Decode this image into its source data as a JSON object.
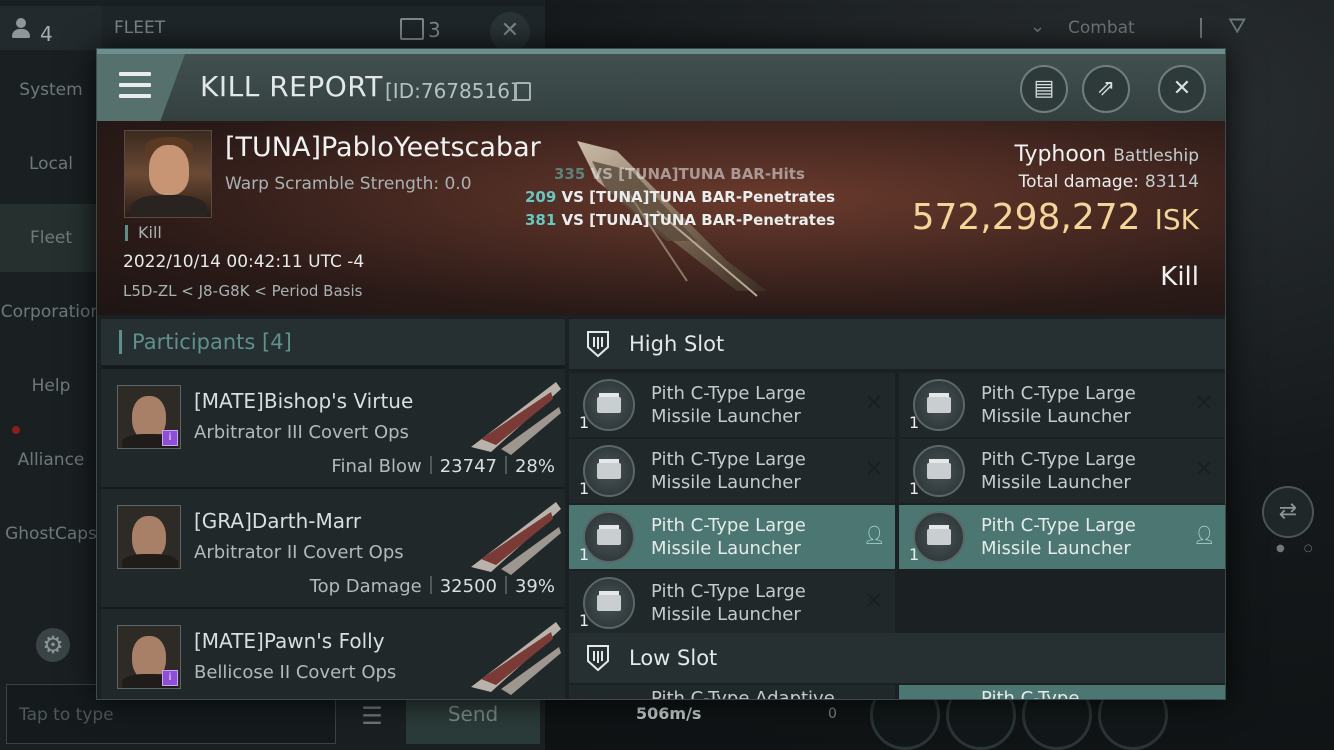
{
  "background": {
    "user_count": "4",
    "fleet_label": "FLEET",
    "fleet_count": "3",
    "nav": [
      {
        "label": "System",
        "active": false
      },
      {
        "label": "Local",
        "active": false
      },
      {
        "label": "Fleet",
        "active": true
      },
      {
        "label": "Corporation",
        "active": false
      },
      {
        "label": "Help",
        "active": false
      },
      {
        "label": "Alliance",
        "active": false
      },
      {
        "label": "GhostCaps",
        "active": false
      }
    ],
    "chat_placeholder": "Tap to type",
    "send_label": "Send",
    "combat_label": "Combat",
    "speed": "506m/s",
    "speed_zero": "0"
  },
  "modal": {
    "title": "KILL REPORT",
    "id_text": "[ID:7678516]",
    "icons": [
      "clipboard-icon",
      "share-icon",
      "close-icon"
    ]
  },
  "victim": {
    "name": "[TUNA]PabloYeetscabar",
    "scramble": "Warp Scramble Strength: 0.0",
    "kill_tag": "Kill",
    "datetime": "2022/10/14 00:42:11 UTC -4",
    "location": "L5D-ZL < J8-G8K < Period Basis",
    "ship_name": "Typhoon",
    "ship_class": "Battleship",
    "total_damage_label": "Total damage:",
    "total_damage": "83114",
    "isk_value": "572,298,272",
    "isk_unit": "ISK",
    "result": "Kill",
    "hits": [
      {
        "num": "335",
        "text": "VS [TUNA]TUNA BAR-Hits",
        "faded": true
      },
      {
        "num": "209",
        "text": "VS [TUNA]TUNA BAR-Penetrates",
        "faded": false
      },
      {
        "num": "381",
        "text": "VS [TUNA]TUNA BAR-Penetrates",
        "faded": false
      }
    ]
  },
  "participants": {
    "label": "Participants",
    "count": "[4]",
    "rows": [
      {
        "name": "[MATE]Bishop's Virtue",
        "ship": "Arbitrator III Covert Ops",
        "role": "Final Blow",
        "damage": "23747",
        "percent": "28%",
        "badge": true
      },
      {
        "name": "[GRA]Darth-Marr",
        "ship": "Arbitrator II Covert Ops",
        "role": "Top Damage",
        "damage": "32500",
        "percent": "39%",
        "badge": false
      },
      {
        "name": "[MATE]Pawn's Folly",
        "ship": "Bellicose II Covert Ops",
        "role": "",
        "damage": "",
        "percent": "",
        "badge": true
      }
    ]
  },
  "slots": {
    "high_label": "High Slot",
    "low_label": "Low Slot",
    "high": [
      {
        "qty": "1",
        "line1": "Pith C-Type Large",
        "line2": "Missile Launcher",
        "state": "destroyed"
      },
      {
        "qty": "1",
        "line1": "Pith C-Type Large",
        "line2": "Missile Launcher",
        "state": "destroyed"
      },
      {
        "qty": "1",
        "line1": "Pith C-Type Large",
        "line2": "Missile Launcher",
        "state": "destroyed"
      },
      {
        "qty": "1",
        "line1": "Pith C-Type Large",
        "line2": "Missile Launcher",
        "state": "destroyed"
      },
      {
        "qty": "1",
        "line1": "Pith C-Type Large",
        "line2": "Missile Launcher",
        "state": "dropped"
      },
      {
        "qty": "1",
        "line1": "Pith C-Type Large",
        "line2": "Missile Launcher",
        "state": "dropped"
      },
      {
        "qty": "1",
        "line1": "Pith C-Type Large",
        "line2": "Missile Launcher",
        "state": "destroyed"
      }
    ],
    "low_partial": [
      {
        "text": "Pith C-Type Adaptive"
      },
      {
        "text": "Pith C-Type"
      }
    ]
  }
}
